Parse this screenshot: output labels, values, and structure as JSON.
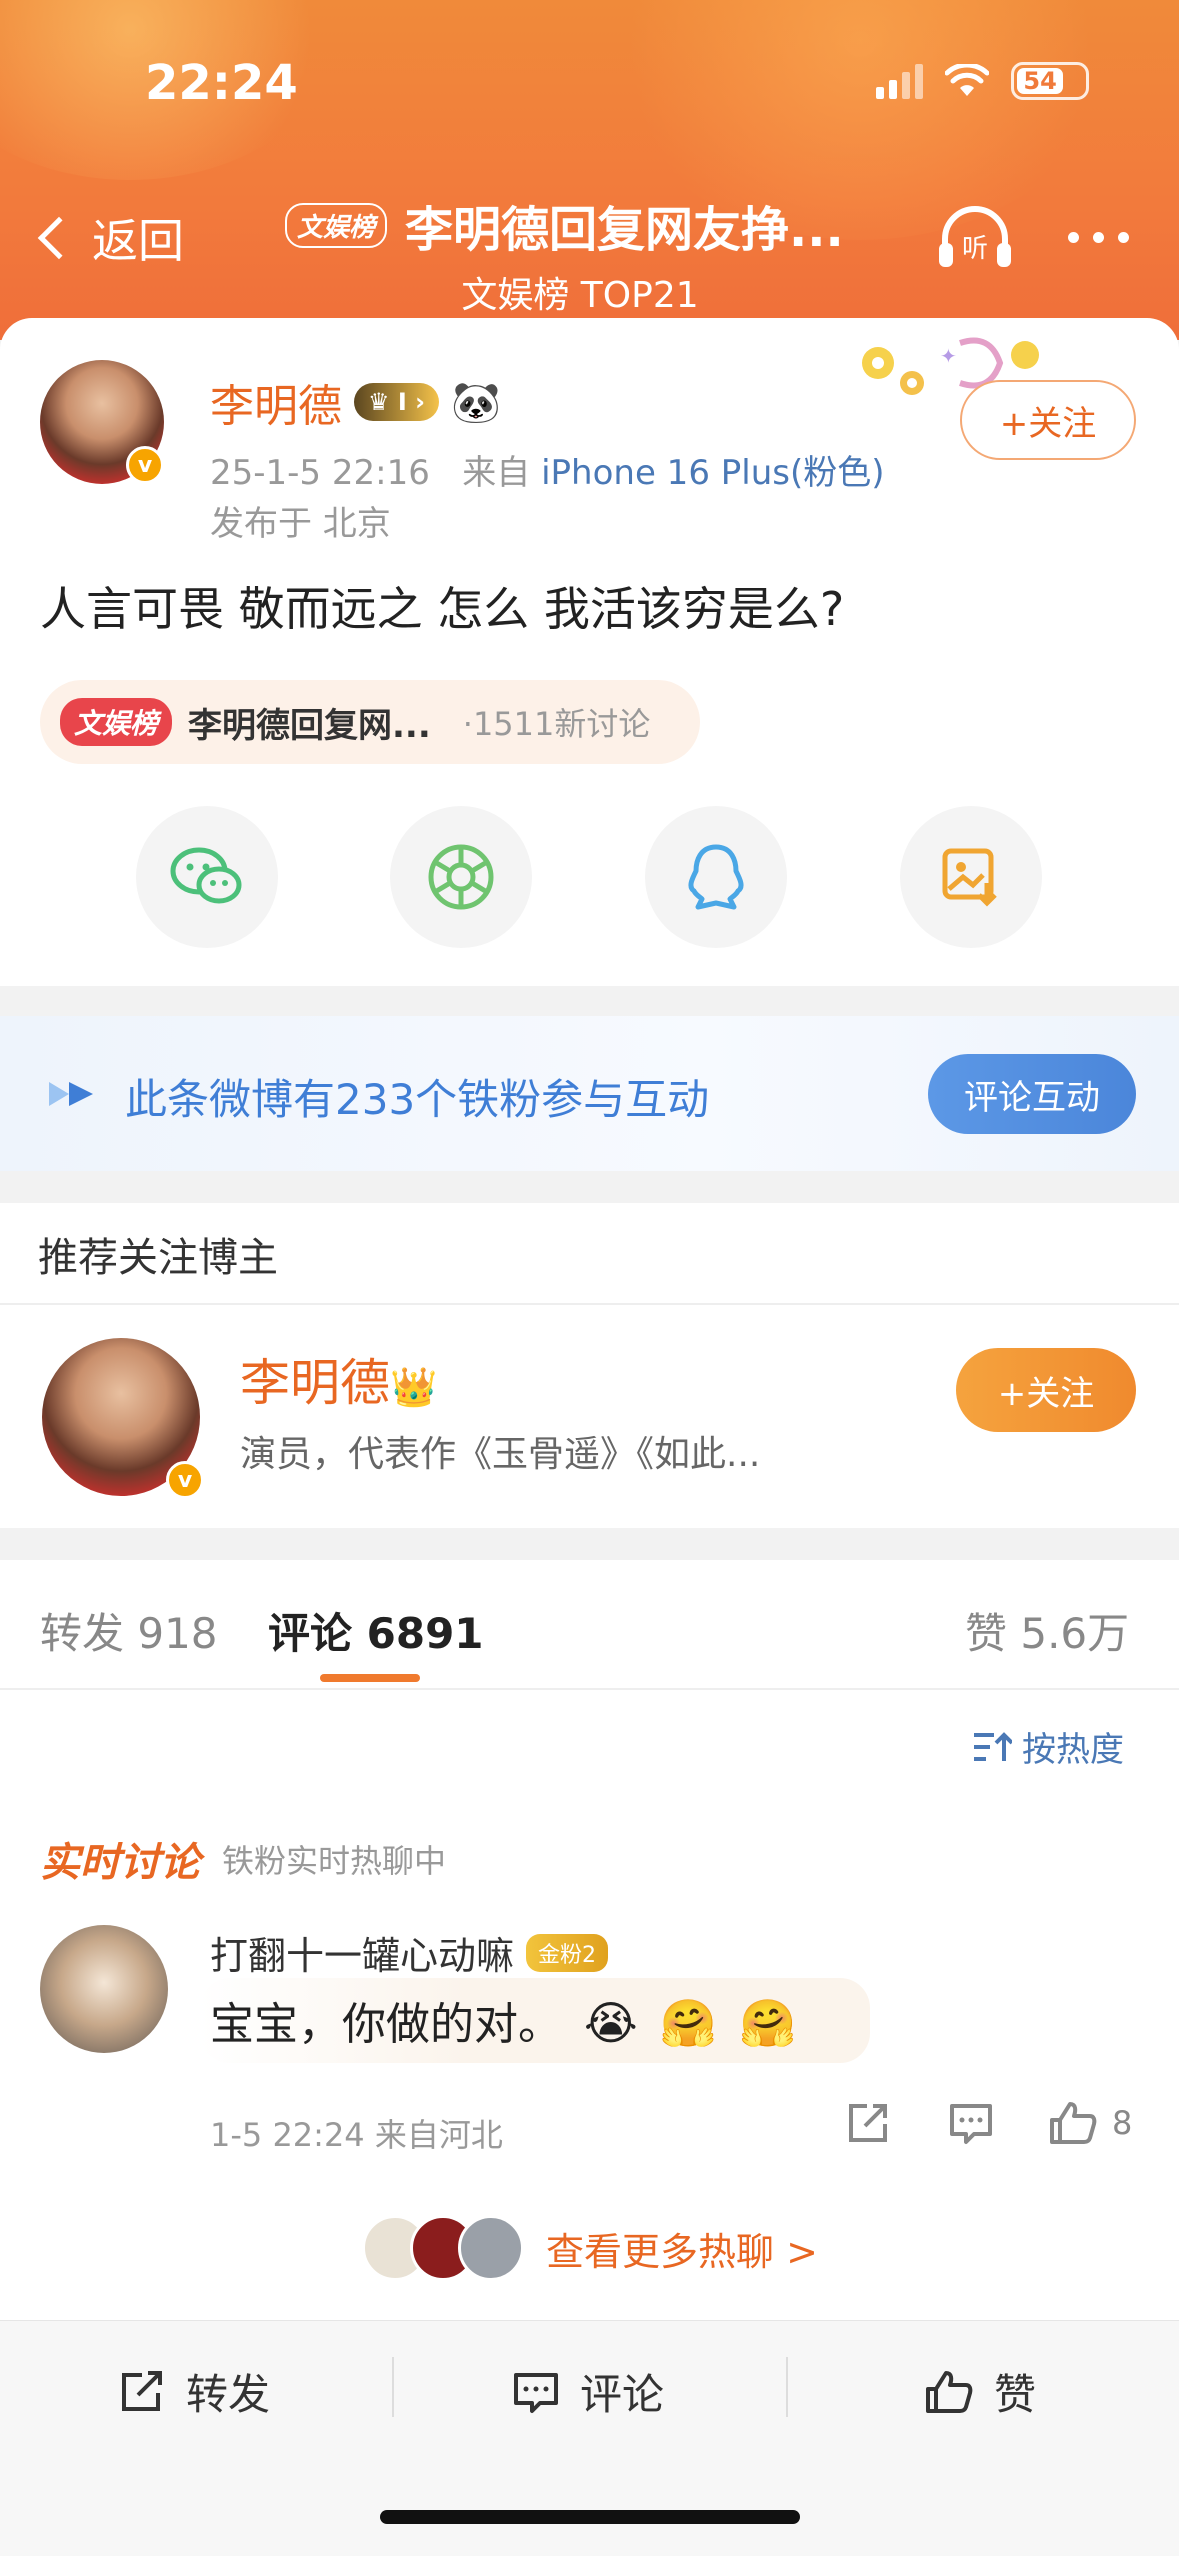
{
  "status": {
    "time": "22:24",
    "battery": "54"
  },
  "nav": {
    "back_label": "返回",
    "tag": "文娱榜",
    "title": "李明德回复网友挣...",
    "subtitle": "文娱榜 TOP21",
    "listen_label": "听"
  },
  "post": {
    "author": "李明德",
    "level_badge": "I",
    "time": "25-1-5 22:16",
    "source_prefix": "来自",
    "device": "iPhone 16 Plus(粉色)",
    "location": "发布于 北京",
    "follow_label": "+关注",
    "text": "人言可畏 敬而远之  怎么 我活该穷是么?",
    "topic": {
      "tag": "文娱榜",
      "name": "李明德回复网...",
      "count": "·1511新讨论"
    },
    "share_targets": [
      "wechat-icon",
      "moments-icon",
      "qq-icon",
      "save-image-icon"
    ]
  },
  "fans": {
    "text": "此条微博有233个铁粉参与互动",
    "button": "评论互动"
  },
  "recommend": {
    "title": "推荐关注博主",
    "name": "李明德",
    "desc": "演员，代表作《玉骨遥》《如此...",
    "follow_label": "+关注"
  },
  "tabs": {
    "repost": "转发 918",
    "comment": "评论 6891",
    "like": "赞 5.6万"
  },
  "sort_label": "按热度",
  "live": {
    "title": "实时讨论",
    "subtitle": "铁粉实时热聊中"
  },
  "comment": {
    "user": "打翻十一罐心动嘛",
    "badge": "金粉2",
    "text": "宝宝，你做的对。",
    "meta": "1-5 22:24  来自河北",
    "likes": "8"
  },
  "more_hot": "查看更多热聊 >",
  "bottom": {
    "repost": "转发",
    "comment": "评论",
    "like": "赞"
  },
  "colors": {
    "accent": "#e86722",
    "link": "#4a78b5",
    "header": "#f07a3a"
  }
}
